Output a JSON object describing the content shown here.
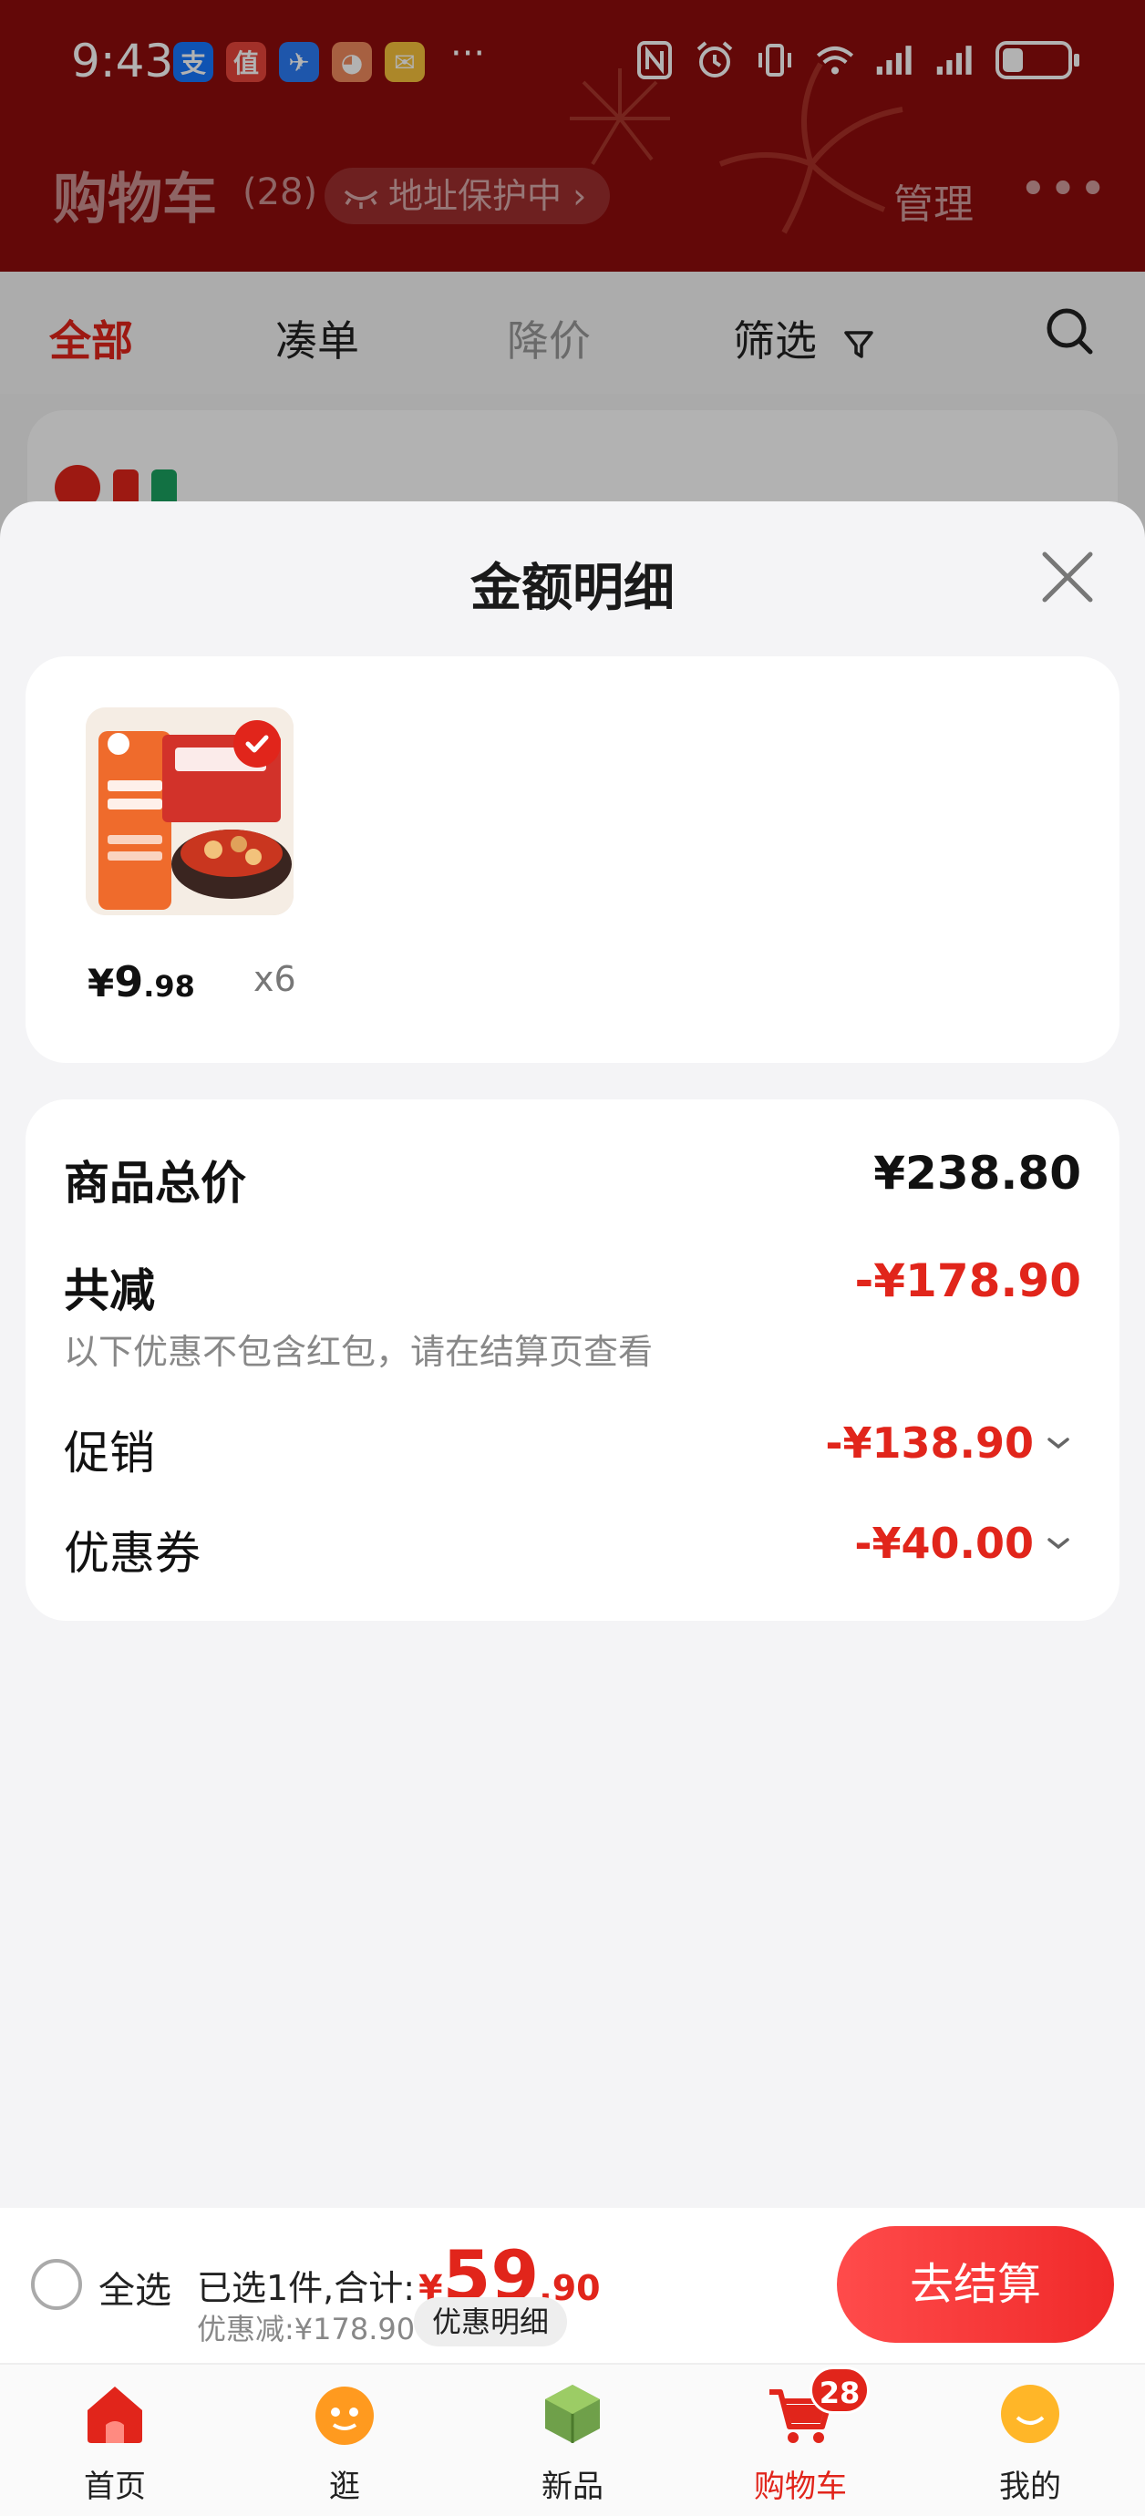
{
  "status_bar": {
    "time": "9:43",
    "apps": [
      {
        "icon": "alipay-icon",
        "glyph": "支",
        "color": "#1677ff"
      },
      {
        "icon": "zhidemai-icon",
        "glyph": "值",
        "color": "#e8453c"
      },
      {
        "icon": "feishu-icon",
        "glyph": "✈",
        "color": "#2b7cf5"
      },
      {
        "icon": "cartoon-app-icon",
        "glyph": "◕",
        "color": "#f08a5d"
      },
      {
        "icon": "mail-icon",
        "glyph": "✉",
        "color": "#f7c23b"
      }
    ],
    "more": "···"
  },
  "header": {
    "title": "购物车",
    "count": "(28)",
    "address_pill": "地址保护中 ›",
    "manage": "管理",
    "more": "•••"
  },
  "tabs": [
    {
      "label": "全部",
      "state": "active"
    },
    {
      "label": "凑单",
      "state": "normal"
    },
    {
      "label": "降价",
      "state": "muted"
    },
    {
      "label": "筛选",
      "state": "normal"
    }
  ],
  "sheet": {
    "title": "金额明细",
    "product": {
      "price_yen": "¥",
      "price_int": "9",
      "price_dec": ".98",
      "qty": "x6"
    },
    "rows": {
      "total_label": "商品总价",
      "total_value": "¥238.80",
      "reduce_label": "共减",
      "reduce_value": "-¥178.90",
      "reduce_note": "以下优惠不包含红包，请在结算页查看",
      "promo_label": "促销",
      "promo_value": "-¥138.90",
      "coupon_label": "优惠券",
      "coupon_value": "-¥40.00"
    }
  },
  "checkout": {
    "select_all": "全选",
    "sum_label": "已选1件,合计:",
    "sum_yen": "¥",
    "sum_int": "59",
    "sum_dec": ".90",
    "discount_text": "优惠减:¥178.90",
    "detail_button": "优惠明细",
    "checkout_button": "去结算"
  },
  "tabbar": [
    {
      "label": "首页",
      "icon": "home-icon",
      "active": false
    },
    {
      "label": "逛",
      "icon": "stroll-icon",
      "active": false
    },
    {
      "label": "新品",
      "icon": "new-products-icon",
      "active": false
    },
    {
      "label": "购物车",
      "icon": "cart-icon",
      "active": true,
      "badge": "28"
    },
    {
      "label": "我的",
      "icon": "profile-icon",
      "active": false
    }
  ],
  "colors": {
    "brand_red": "#e1251b",
    "header_bg": "#8e0c0c"
  }
}
